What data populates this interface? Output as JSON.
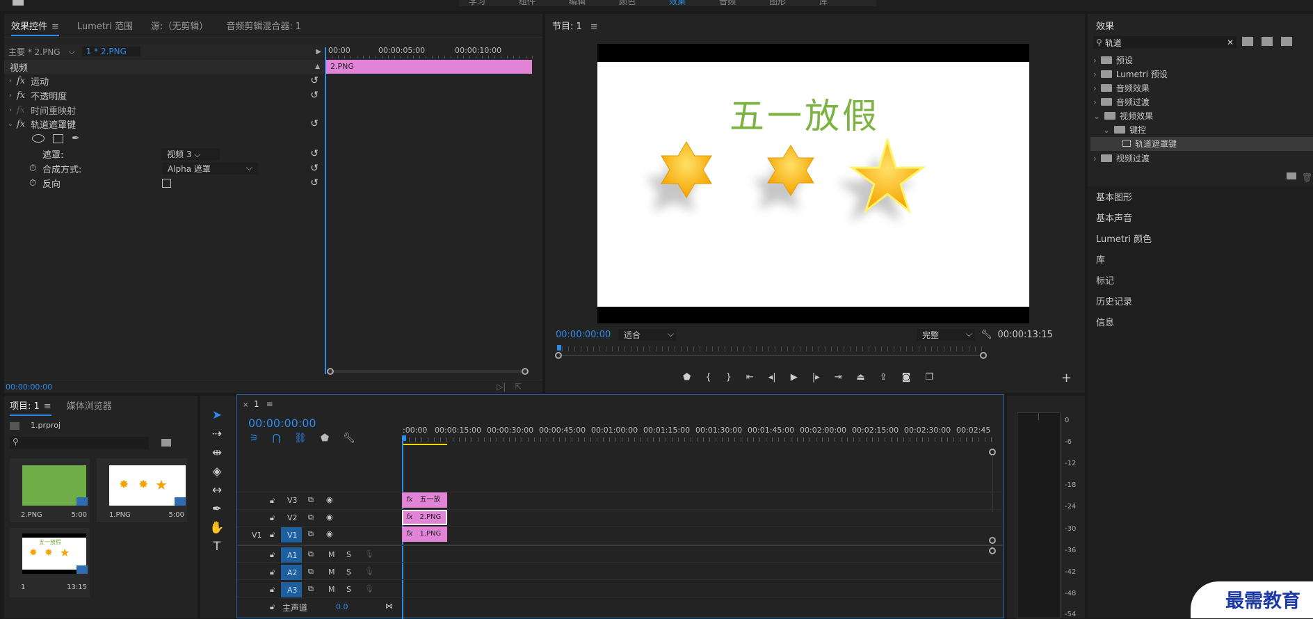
{
  "workspaces": {
    "items": [
      "学习",
      "组件",
      "编辑",
      "颜色",
      "效果",
      "音频",
      "图形",
      "库"
    ]
  },
  "effect_controls": {
    "tabs": [
      "效果控件",
      "Lumetri 范围",
      "源:（无剪辑）",
      "音频剪辑混合器: 1"
    ],
    "master_label": "主要 * 2.PNG",
    "clip_label": "1 * 2.PNG",
    "ruler": [
      "00:00",
      "00:00:05:00",
      "00:00:10:00"
    ],
    "clip_name": "2.PNG",
    "section": "视频",
    "effects": [
      "运动",
      "不透明度",
      "时间重映射",
      "轨道遮罩键"
    ],
    "mask_label": "遮罩:",
    "mask_value": "视频 3",
    "composite_label": "合成方式:",
    "composite_value": "Alpha 遮罩",
    "invert_label": "反向",
    "timecode": "00:00:00:00"
  },
  "program": {
    "title": "节目: 1",
    "frame_title": "五一放假",
    "timecode": "00:00:00:00",
    "fit": "适合",
    "quality": "完整",
    "duration": "00:00:13:15"
  },
  "effects_panel": {
    "title": "效果",
    "search": "轨道",
    "tree": [
      "预设",
      "Lumetri 预设",
      "音频效果",
      "音频过渡",
      "视频效果",
      "键控",
      "轨道遮罩键",
      "视频过渡"
    ]
  },
  "right_panels": [
    "基本图形",
    "基本声音",
    "Lumetri 颜色",
    "库",
    "标记",
    "历史记录",
    "信息"
  ],
  "project": {
    "tabs": [
      "项目: 1",
      "媒体浏览器"
    ],
    "file": "1.prproj",
    "items": [
      {
        "name": "2.PNG",
        "dur": "5:00"
      },
      {
        "name": "1.PNG",
        "dur": "5:00"
      },
      {
        "name": "1",
        "dur": "13:15"
      }
    ],
    "thumb_text": "五一放假"
  },
  "timeline": {
    "tab": "1",
    "timecode": "00:00:00:00",
    "ruler": [
      ":00:00",
      "00:00:15:00",
      "00:00:30:00",
      "00:00:45:00",
      "00:01:00:00",
      "00:01:15:00",
      "00:01:30:00",
      "00:01:45:00",
      "00:02:00:00",
      "00:02:15:00",
      "00:02:30:00",
      "00:02:45"
    ],
    "tracks": [
      "V3",
      "V2",
      "V1",
      "A1",
      "A2",
      "A3"
    ],
    "source_patch": "V1",
    "mute": "M",
    "solo": "S",
    "master": "主声道",
    "master_value": "0.0",
    "clips": [
      "五一放",
      "2.PNG",
      "1.PNG"
    ]
  },
  "meter": {
    "labels": [
      "0",
      "-6",
      "-12",
      "-18",
      "-24",
      "-30",
      "-36",
      "-42",
      "-48",
      "-54"
    ]
  },
  "watermark": "最需教育"
}
